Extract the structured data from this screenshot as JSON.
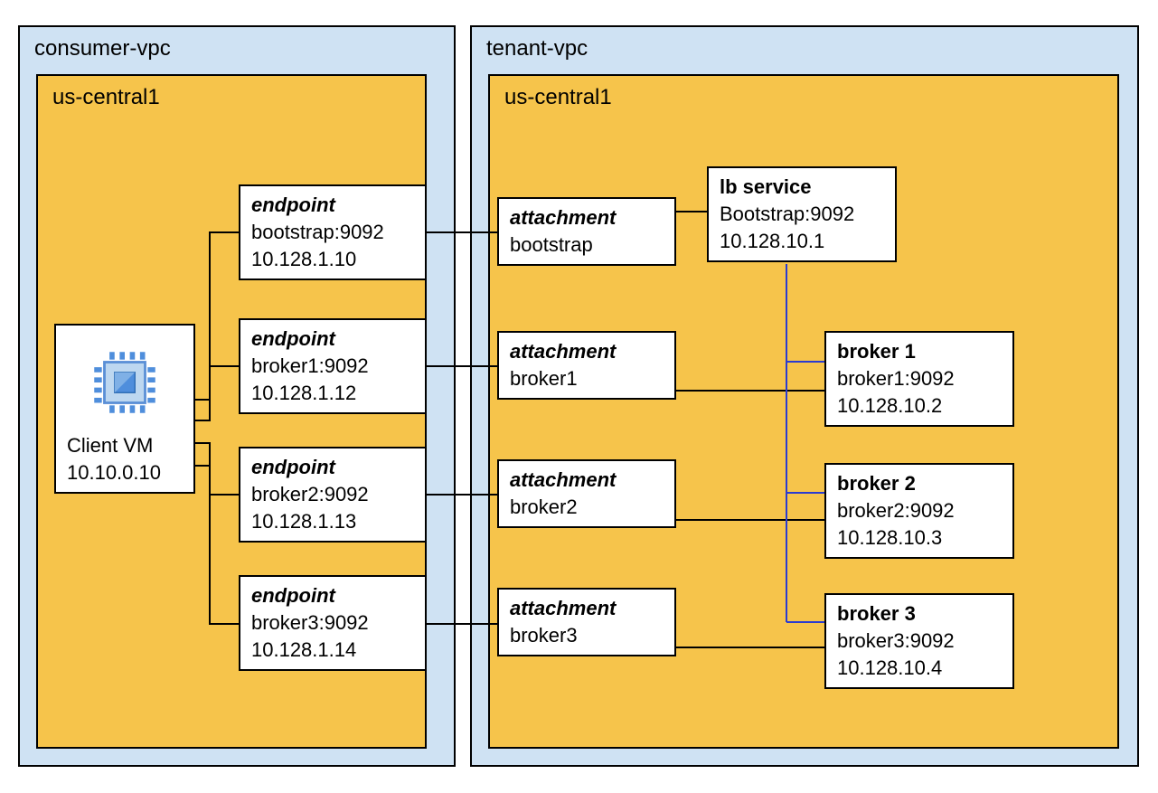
{
  "consumer_vpc": {
    "label": "consumer-vpc",
    "region_label": "us-central1",
    "client_vm": {
      "title": "Client VM",
      "ip": "10.10.0.10"
    },
    "endpoints": [
      {
        "title": "endpoint",
        "addr": "bootstrap:9092",
        "ip": "10.128.1.10"
      },
      {
        "title": "endpoint",
        "addr": "broker1:9092",
        "ip": "10.128.1.12"
      },
      {
        "title": "endpoint",
        "addr": "broker2:9092",
        "ip": "10.128.1.13"
      },
      {
        "title": "endpoint",
        "addr": "broker3:9092",
        "ip": "10.128.1.14"
      }
    ]
  },
  "tenant_vpc": {
    "label": "tenant-vpc",
    "region_label": "us-central1",
    "attachments": [
      {
        "title": "attachment",
        "name": "bootstrap"
      },
      {
        "title": "attachment",
        "name": "broker1"
      },
      {
        "title": "attachment",
        "name": "broker2"
      },
      {
        "title": "attachment",
        "name": "broker3"
      }
    ],
    "lb": {
      "title": "lb service",
      "addr": "Bootstrap:9092",
      "ip": "10.128.10.1"
    },
    "brokers": [
      {
        "title": "broker 1",
        "addr": "broker1:9092",
        "ip": "10.128.10.2"
      },
      {
        "title": "broker 2",
        "addr": "broker2:9092",
        "ip": "10.128.10.3"
      },
      {
        "title": "broker 3",
        "addr": "broker3:9092",
        "ip": "10.128.10.4"
      }
    ]
  }
}
